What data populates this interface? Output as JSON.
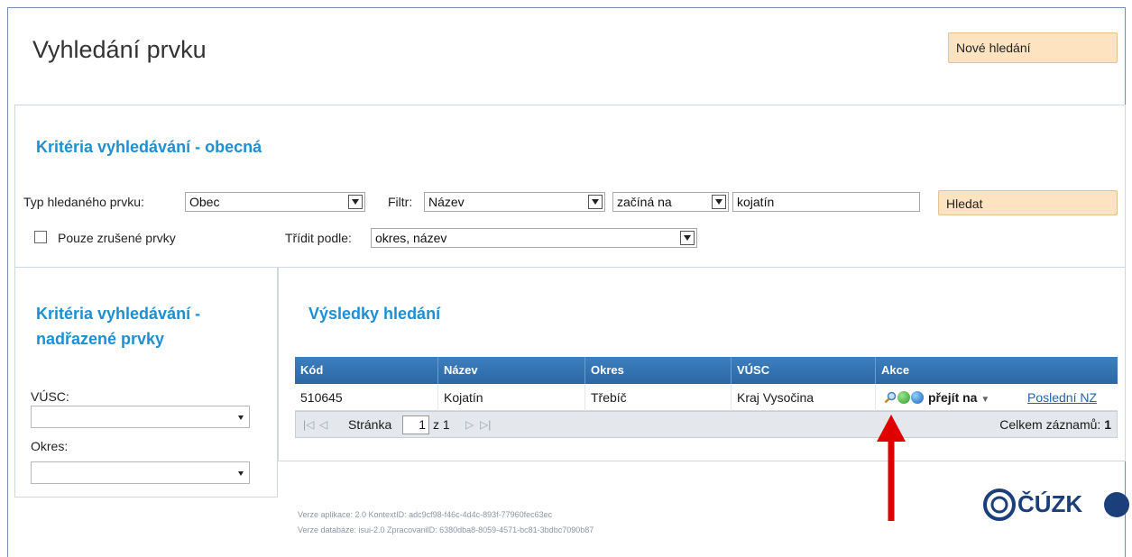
{
  "page": {
    "title": "Vyhledání prvku",
    "new_search_label": "Nové hledání"
  },
  "general": {
    "title": "Kritéria vyhledávání - obecná",
    "type_label": "Typ hledaného prvku:",
    "type_value": "Obec",
    "filter_label": "Filtr:",
    "filter_field": "Název",
    "filter_operator": "začíná na",
    "filter_value": "kojatín",
    "search_label": "Hledat",
    "only_cancelled_label": "Pouze zrušené prvky",
    "only_cancelled_checked": false,
    "sort_label": "Třídit podle:",
    "sort_value": "okres, název"
  },
  "parent": {
    "title_line1": "Kritéria vyhledávání -",
    "title_line2": "nadřazené prvky",
    "vusc_label": "VÚSC:",
    "vusc_value": "",
    "okres_label": "Okres:",
    "okres_value": ""
  },
  "results": {
    "title": "Výsledky hledání",
    "columns": [
      "Kód",
      "Název",
      "Okres",
      "VÚSC",
      "Akce"
    ],
    "rows": [
      {
        "kod": "510645",
        "nazev": "Kojatín",
        "okres": "Třebíč",
        "vusc": "Kraj Vysočina",
        "goto_label": "přejít na",
        "last_link": "Poslední NZ"
      }
    ],
    "pager": {
      "page_label": "Stránka",
      "page_value": "1",
      "of_label": "z 1",
      "total_label": "Celkem záznamů:",
      "total_value": "1"
    }
  },
  "footer": {
    "line1": "Verze aplikace: 2.0 KontextID: adc9cf98-f46c-4d4c-893f-77960fec63ec",
    "line2": "Verze databáze: isui-2.0 ZpracovanilD: 6380dba8-8059-4571-bc81-3bdbc7090b87",
    "logo_text": "ČÚZK"
  },
  "colors": {
    "accent": "#1d8fd3",
    "grid_header": "#2b67a6",
    "button_bg": "#fde3c0",
    "arrow": "#e00000"
  }
}
